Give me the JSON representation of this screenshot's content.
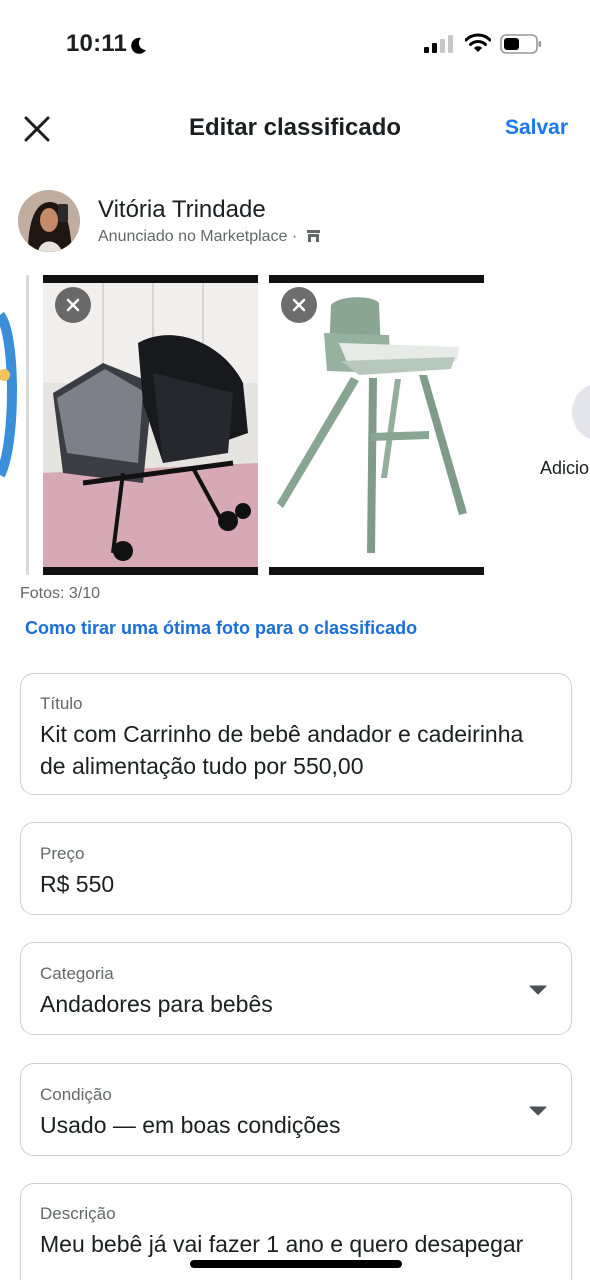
{
  "status_bar": {
    "time": "10:11"
  },
  "header": {
    "title": "Editar classificado",
    "save_label": "Salvar"
  },
  "seller": {
    "name": "Vitória Trindade",
    "subtitle": "Anunciado no Marketplace ·"
  },
  "photos": {
    "items": [
      {
        "name": "stroller-photo",
        "icon": "stroller"
      },
      {
        "name": "high-chair-photo",
        "icon": "high-chair"
      }
    ],
    "add_label": "Adicio",
    "count_label": "Fotos: 3/10",
    "tip_link": "Como tirar uma ótima foto para o classificado"
  },
  "form": {
    "title": {
      "label": "Título",
      "value": "Kit com Carrinho de bebê andador e cadeirinha de alimentação tudo por 550,00"
    },
    "price": {
      "label": "Preço",
      "value": "R$ 550"
    },
    "category": {
      "label": "Categoria",
      "value": "Andadores para bebês"
    },
    "condition": {
      "label": "Condição",
      "value": "Usado — em boas condições"
    },
    "description": {
      "label": "Descrição",
      "value": "Meu bebê já vai fazer 1 ano e quero desapegar"
    }
  },
  "colors": {
    "accent": "#1877f2",
    "link": "#1a6ed8",
    "border": "#ced0d4",
    "muted": "#65676b"
  }
}
